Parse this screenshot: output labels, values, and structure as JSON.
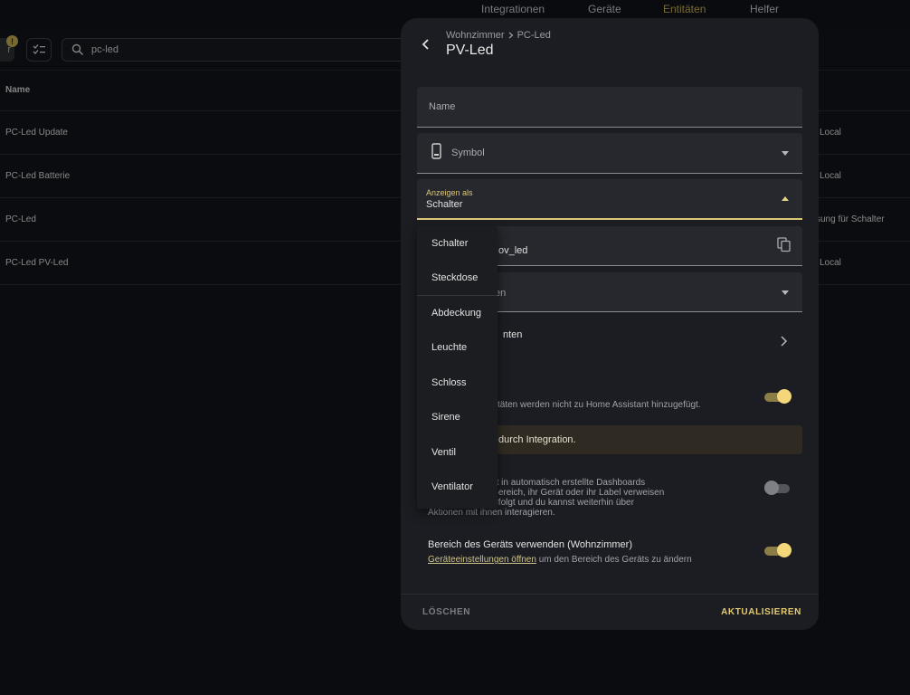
{
  "topnav": [
    "Integrationen",
    "Geräte",
    "Entitäten",
    "Helfer"
  ],
  "toolbar": {
    "filter_badge": "!",
    "filter_chip_text": "r",
    "search_value": "pc-led"
  },
  "table": {
    "header_name": "Name",
    "rows": [
      {
        "name": "PC-Led Update",
        "integration": "Local"
      },
      {
        "name": "PC-Led Batterie",
        "integration": "Local"
      },
      {
        "name": "PC-Led",
        "integration": "sung für Schalter"
      },
      {
        "name": "PC-Led PV-Led",
        "integration": "Local"
      }
    ]
  },
  "dialog": {
    "breadcrumb_area": "Wohnzimmer",
    "breadcrumb_device": "PC-Led",
    "title": "PV-Led",
    "name_label": "Name",
    "symbol_label": "Symbol",
    "show_as_label": "Anzeigen als",
    "show_as_value": "Schalter",
    "entity_id_value": "ov_led",
    "area_fragment": "en",
    "advanced_fragment": "nten",
    "enabled_desc": "täten werden nicht zu Home Assistant hinzugefügt.",
    "banner_text": "durch Integration.",
    "visible_desc": "sten werden nicht in automatisch erstellte Dashboards\n wenn auf ihren Bereich, ihr Gerät oder ihr Label verweisen\nwird weiterhin verfolgt und du kannst weiterhin über\nAktionen mit ihnen interagieren.",
    "use_device_area_label": "Bereich des Geräts verwenden (Wohnzimmer)",
    "device_settings_link": "Geräteeinstellungen öffnen",
    "device_area_desc": " um den Bereich des Geräts zu ändern",
    "delete_label": "LÖSCHEN",
    "update_label": "AKTUALISIEREN"
  },
  "menu": {
    "options": [
      "Schalter",
      "Steckdose",
      "Abdeckung",
      "Leuchte",
      "Schloss",
      "Sirene",
      "Ventil",
      "Ventilator"
    ]
  },
  "colors": {
    "accent": "#dcc874",
    "background": "#111318",
    "dialog": "#1c1d22"
  }
}
